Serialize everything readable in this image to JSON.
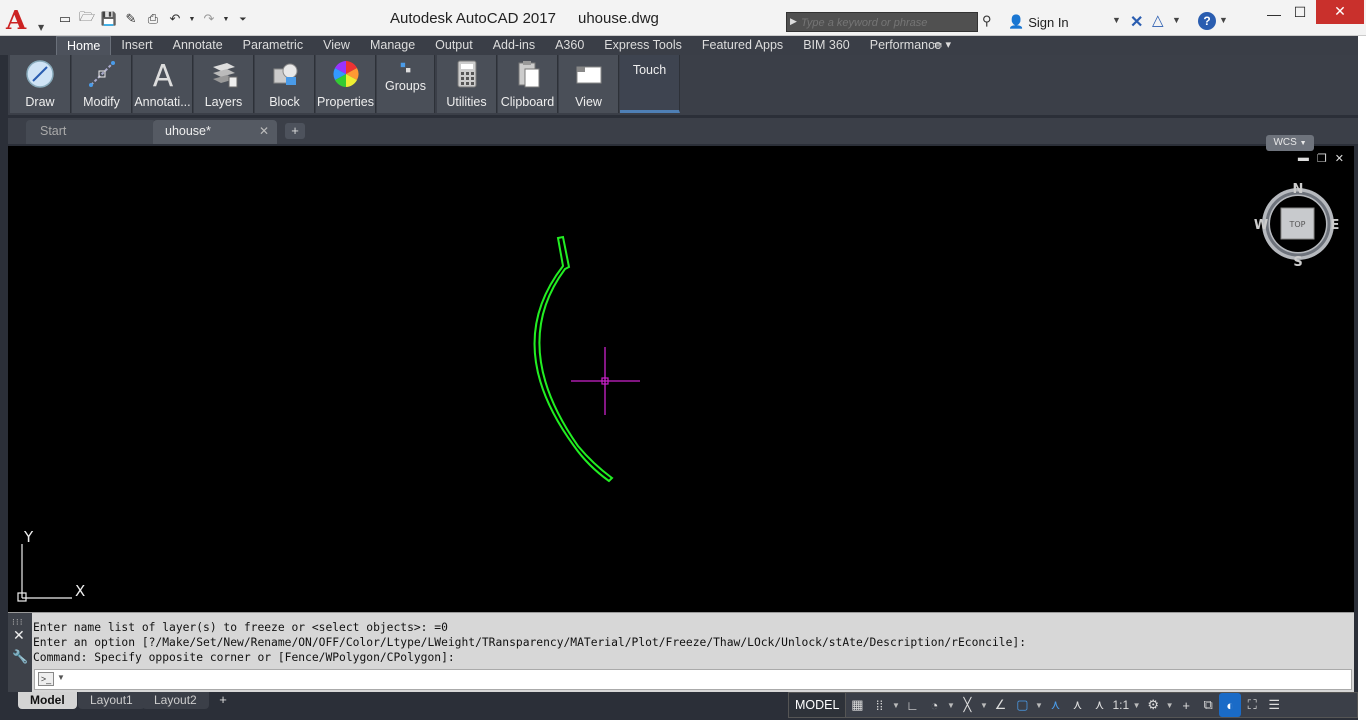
{
  "window": {
    "app_title": "Autodesk AutoCAD 2017",
    "doc_title": "uhouse.dwg",
    "search_placeholder": "Type a keyword or phrase",
    "sign_in": "Sign In",
    "help_glyph": "?"
  },
  "ribbon": {
    "tabs": [
      "Home",
      "Insert",
      "Annotate",
      "Parametric",
      "View",
      "Manage",
      "Output",
      "Add-ins",
      "A360",
      "Express Tools",
      "Featured Apps",
      "BIM 360",
      "Performance"
    ],
    "active_tab": "Home",
    "panels": {
      "draw": "Draw",
      "modify": "Modify",
      "annotation": "Annotati...",
      "layers": "Layers",
      "block": "Block",
      "properties": "Properties",
      "groups": "Groups",
      "utilities": "Utilities",
      "clipboard": "Clipboard",
      "view": "View",
      "touch": "Touch"
    }
  },
  "doc_tabs": {
    "start": "Start",
    "current": "uhouse*"
  },
  "viewcube": {
    "north": "N",
    "south": "S",
    "east": "E",
    "west": "W",
    "face": "TOP",
    "wcs": "WCS"
  },
  "ucs": {
    "x": "X",
    "y": "Y"
  },
  "command": {
    "history": [
      "Enter name list of layer(s) to freeze or <select objects>: =0",
      "Enter an option [?/Make/Set/New/Rename/ON/OFF/Color/Ltype/LWeight/TRansparency/MATerial/Plot/Freeze/Thaw/LOck/Unlock/stAte/Description/rEconcile]:",
      "Command: Specify opposite corner or [Fence/WPolygon/CPolygon]:"
    ],
    "input_value": ""
  },
  "layout_tabs": [
    "Model",
    "Layout1",
    "Layout2"
  ],
  "status": {
    "model": "MODEL",
    "scale": "1:1"
  },
  "colors": {
    "arc": "#22ee22",
    "crosshair": "#cc22cc",
    "canvas": "#000000",
    "accent": "#1a6bc7"
  }
}
